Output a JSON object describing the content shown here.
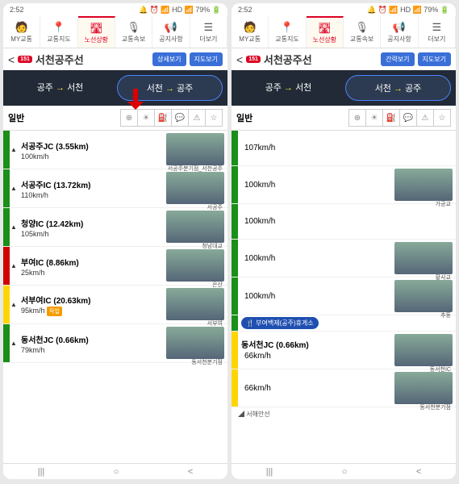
{
  "status": {
    "time": "2:52",
    "icons": "🔔 ⏰ 📶 HD 📶 79% 🔋"
  },
  "tabs": [
    "MY교통",
    "교통지도",
    "노선상황",
    "교통속보",
    "공지사항",
    "더보기"
  ],
  "tabIcons": [
    "🧑",
    "📍",
    "🛣",
    "🎙",
    "📢",
    "☰"
  ],
  "activeTab": 2,
  "shield": "151",
  "routeName": "서천공주선",
  "btnDetail": "상세보기",
  "btnSimple": "간략보기",
  "btnMap": "지도보기",
  "dirA": {
    "from": "공주",
    "to": "서천"
  },
  "dirB": {
    "from": "서천",
    "to": "공주"
  },
  "filterLabel": "일반",
  "left": {
    "rows": [
      {
        "bar": "g",
        "title": "서공주JC (3.55km)",
        "speed": "100km/h",
        "cap": "서공주분기점_서천공주"
      },
      {
        "bar": "g",
        "title": "서공주IC (13.72km)",
        "speed": "110km/h",
        "cap": "서공주"
      },
      {
        "bar": "g",
        "title": "청양IC (12.42km)",
        "speed": "105km/h",
        "cap": "청남대교"
      },
      {
        "bar": "r",
        "title": "부여IC (8.86km)",
        "speed": "25km/h",
        "cap": "은산"
      },
      {
        "bar": "y",
        "title": "서부여IC (20.63km)",
        "speed": "95km/h",
        "badge": "작업",
        "cap": "서부여"
      },
      {
        "bar": "g",
        "title": "동서천JC (0.66km)",
        "speed": "79km/h",
        "cap": "동서천분기점"
      }
    ]
  },
  "right": {
    "rows": [
      {
        "bar": "g",
        "speed": "107km/h"
      },
      {
        "bar": "g",
        "speed": "100km/h",
        "cap": "가공교"
      },
      {
        "bar": "g",
        "speed": "100km/h"
      },
      {
        "bar": "g",
        "speed": "100km/h",
        "cap": "황사교"
      },
      {
        "bar": "g",
        "speed": "100km/h",
        "cap": "추동"
      }
    ],
    "restStop": "부여백제(공주)휴게소",
    "after": [
      {
        "bar": "y",
        "title": "동서천JC (0.66km)",
        "speed": "66km/h",
        "cap": "동서천IC"
      },
      {
        "bar": "y",
        "speed": "66km/h",
        "cap": "동서천분기점"
      }
    ],
    "sea": "서해안선"
  },
  "nav": [
    "|||",
    "○",
    "<"
  ]
}
